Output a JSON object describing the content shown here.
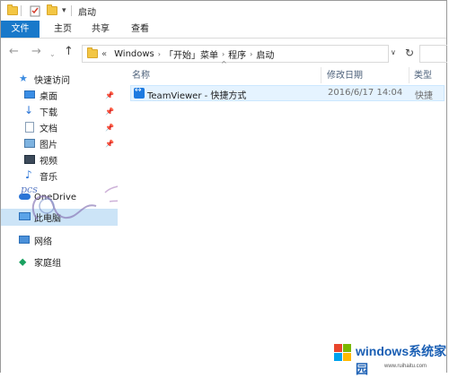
{
  "window": {
    "title": "启动"
  },
  "ribbon": {
    "tabs": [
      "文件",
      "主页",
      "共享",
      "查看"
    ]
  },
  "address": {
    "overflow": "«",
    "parts": [
      "Windows",
      "「开始」菜单",
      "程序",
      "启动"
    ]
  },
  "nav": {
    "quick_access": "快速访问",
    "items": [
      {
        "label": "桌面",
        "icon": "desktop-icon"
      },
      {
        "label": "下载",
        "icon": "download-icon"
      },
      {
        "label": "文档",
        "icon": "document-icon"
      },
      {
        "label": "图片",
        "icon": "pictures-icon"
      },
      {
        "label": "视频",
        "icon": "video-icon"
      },
      {
        "label": "音乐",
        "icon": "music-icon"
      }
    ],
    "onedrive": "OneDrive",
    "this_pc": "此电脑",
    "network": "网络",
    "homegroup": "家庭组"
  },
  "columns": {
    "name": "名称",
    "date": "修改日期",
    "type": "类型"
  },
  "files": [
    {
      "name": "TeamViewer - 快捷方式",
      "date": "2016/6/17 14:04",
      "type": "快捷"
    }
  ],
  "watermark": {
    "text": "pcs"
  },
  "brand": {
    "title": "windows系统家园",
    "sub": "www.ruihaitu.com"
  },
  "colors": {
    "accent": "#1979ca",
    "selection": "#cce4f7",
    "row_highlight": "#e5f3ff"
  }
}
